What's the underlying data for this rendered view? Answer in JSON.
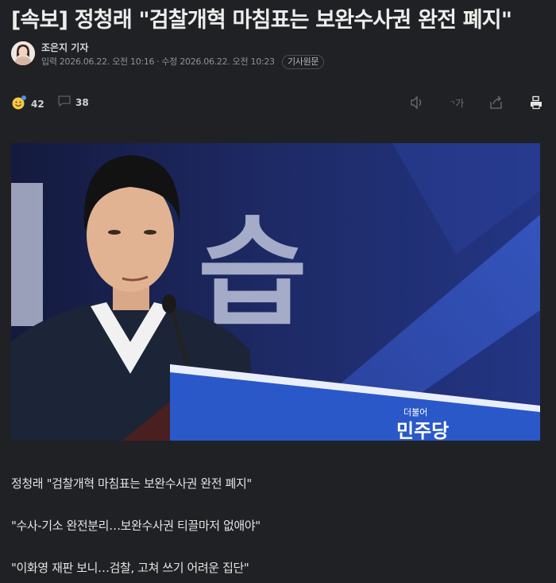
{
  "article": {
    "headline": "[속보] 정청래 \"검찰개혁 마침표는 보완수사권 완전 폐지\"",
    "author": "조은지 기자",
    "input_label": "입력",
    "input_date": "2026.06.22. 오전 10:16",
    "separator": "·",
    "modified_label": "수정",
    "modified_date": "2026.06.22. 오전 10:23",
    "original_button": "기사원문"
  },
  "reactions": {
    "like_count": "42",
    "comment_count": "38"
  },
  "toolbar": {
    "font_size_label": "가",
    "icons": [
      "speaker-icon",
      "font-size-icon",
      "share-icon",
      "print-icon"
    ]
  },
  "photo": {
    "podium_brand": "민주당",
    "podium_sub": "더불어",
    "banner_text": "습"
  },
  "paragraphs": [
    "정청래 \"검찰개혁 마침표는 보완수사권 완전 폐지\"",
    "\"수사-기소 완전분리…보완수사권 티끌마저 없애야\"",
    "\"이화영 재판 보니…검찰, 고쳐 쓰기 어려운 집단\""
  ],
  "colors": {
    "background": "#202124",
    "podium_blue": "#2b58c9",
    "banner_navy": "#1d2656"
  }
}
